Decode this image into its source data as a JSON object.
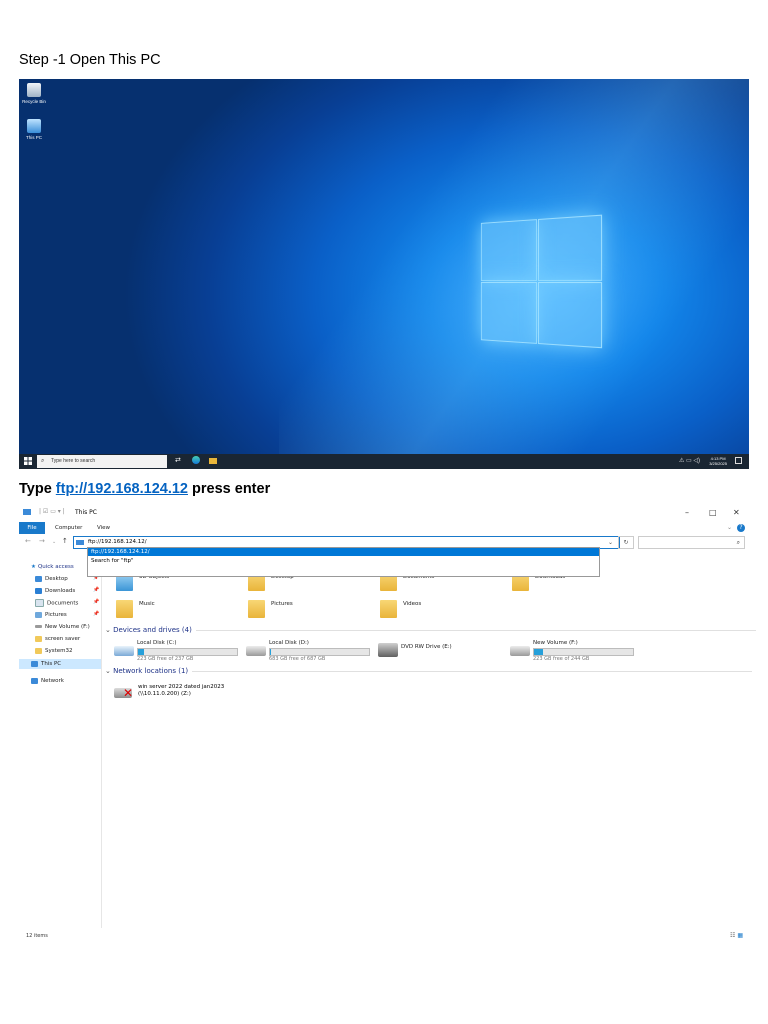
{
  "doc": {
    "step1": "Step -1 Open This PC",
    "step2_prefix": "Type ",
    "step2_link": "ftp://192.168.124.12",
    "step2_suffix": " press enter"
  },
  "desktop": {
    "icons": [
      "Recycle Bin",
      "This PC"
    ],
    "search_placeholder": "Type here to search",
    "clock_time": "4:13 PM",
    "clock_date": "3/25/2025"
  },
  "explorer": {
    "title": "This PC",
    "ribbon_tabs": [
      "File",
      "Computer",
      "View"
    ],
    "address_value": "ftp://192.168.124.12/",
    "suggestion_1": "ftp://192.168.124.12/",
    "suggestion_2": "Search for \"ftp\"",
    "nav": {
      "quick_access": "Quick access",
      "items": [
        "Desktop",
        "Downloads",
        "Documents",
        "Pictures",
        "New Volume (F:)",
        "screen saver",
        "System32"
      ],
      "this_pc": "This PC",
      "network": "Network"
    },
    "folders": [
      "3D Objects",
      "Desktop",
      "Documents",
      "Downloads",
      "Music",
      "Pictures",
      "Videos"
    ],
    "devices_header": "Devices and drives (4)",
    "drives": [
      {
        "name": "Local Disk (C:)",
        "free": "223 GB free of 237 GB",
        "used_pct": 6
      },
      {
        "name": "Local Disk (D:)",
        "free": "683 GB free of 687 GB",
        "used_pct": 1
      },
      {
        "name": "DVD RW Drive (E:)",
        "free": "",
        "used_pct": 0
      },
      {
        "name": "New Volume (F:)",
        "free": "223 GB free of 244 GB",
        "used_pct": 9
      }
    ],
    "network_header": "Network locations (1)",
    "network_item_line1": "win server 2022 dated jan2023",
    "network_item_line2": "(\\\\10.11.0.200) (Z:)",
    "status": "12 items"
  },
  "colors": {
    "accent": "#1979ca",
    "link": "#0563c1",
    "selection": "#cce8ff",
    "highlight": "#0078d7",
    "section_text": "#1e3287"
  }
}
